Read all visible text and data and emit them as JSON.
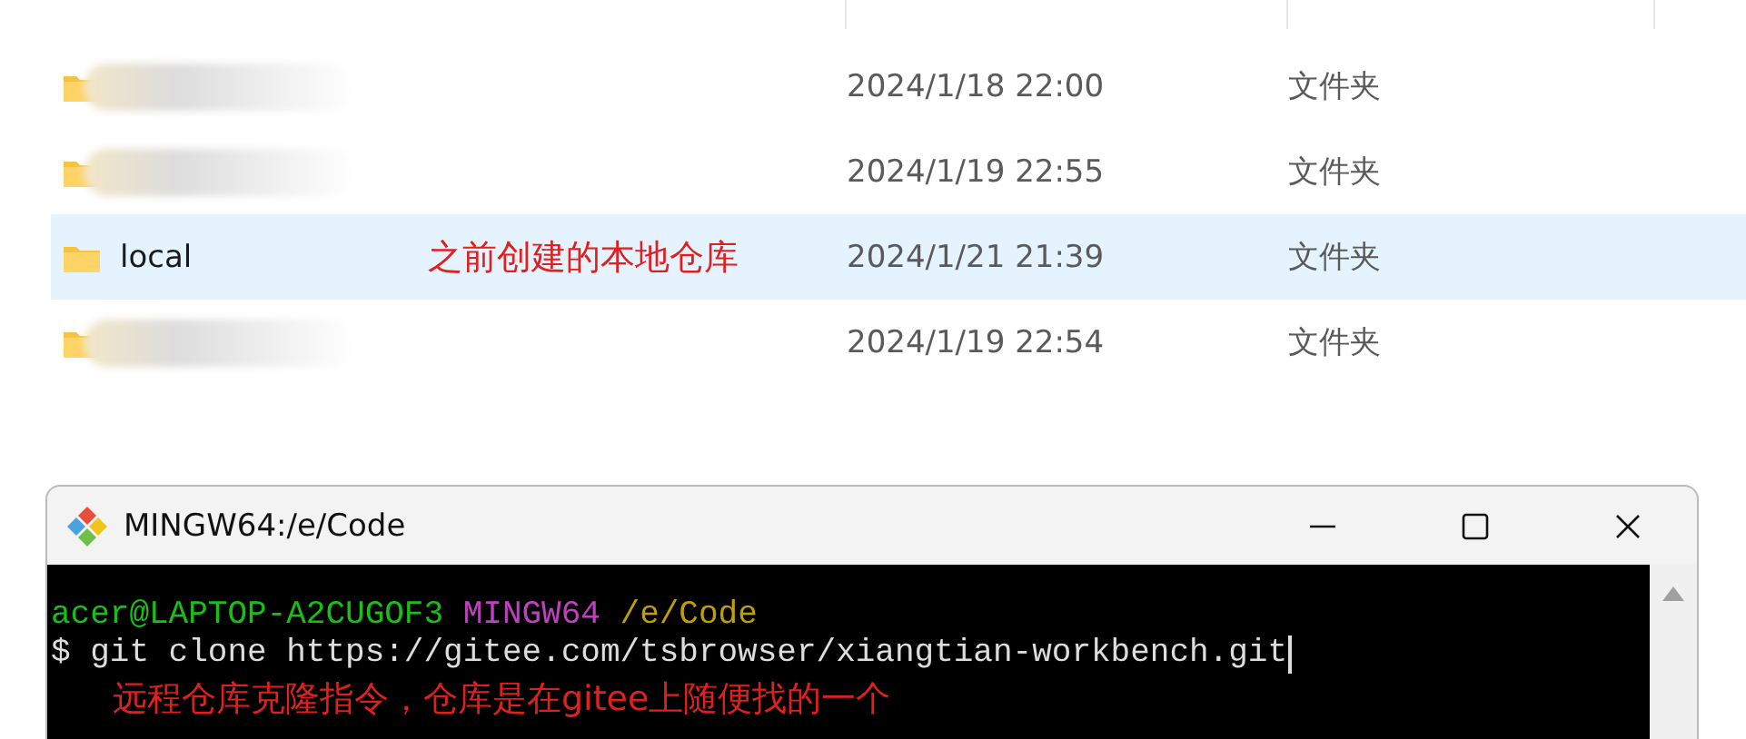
{
  "explorer": {
    "rows": [
      {
        "name": "",
        "redacted": true,
        "date": "2024/1/18 22:00",
        "type": "文件夹",
        "selected": false
      },
      {
        "name": "",
        "redacted": true,
        "date": "2024/1/19 22:55",
        "type": "文件夹",
        "selected": false
      },
      {
        "name": "local",
        "redacted": false,
        "date": "2024/1/21 21:39",
        "type": "文件夹",
        "selected": true,
        "annotation": "之前创建的本地仓库"
      },
      {
        "name": "",
        "redacted": true,
        "date": "2024/1/19 22:54",
        "type": "文件夹",
        "selected": false
      }
    ]
  },
  "terminal": {
    "title": "MINGW64:/e/Code",
    "prompt": [
      {
        "text": "acer@LAPTOP-A2CUGOF3",
        "color": "#17c017"
      },
      {
        "text": "MINGW64",
        "color": "#c040c0"
      },
      {
        "text": "/e/Code",
        "color": "#c0a000"
      }
    ],
    "command": "$ git clone https://gitee.com/tsbrowser/xiangtian-workbench.git",
    "annotation": "远程仓库克隆指令，仓库是在gitee上随便找的一个"
  }
}
